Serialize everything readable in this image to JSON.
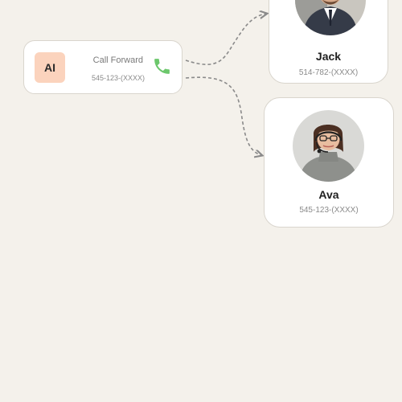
{
  "ai_card": {
    "badge": "AI",
    "title": "Call Forward",
    "phone": "545-123-(XXXX)",
    "icon": "phone-icon",
    "icon_color": "#6cc76c"
  },
  "contacts": [
    {
      "name": "Jack",
      "phone": "514-782-(XXXX)"
    },
    {
      "name": "Ava",
      "phone": "545-123-(XXXX)"
    }
  ],
  "colors": {
    "background": "#f4f1eb",
    "badge": "#fbd3bd",
    "connector": "#8a8a8a"
  }
}
